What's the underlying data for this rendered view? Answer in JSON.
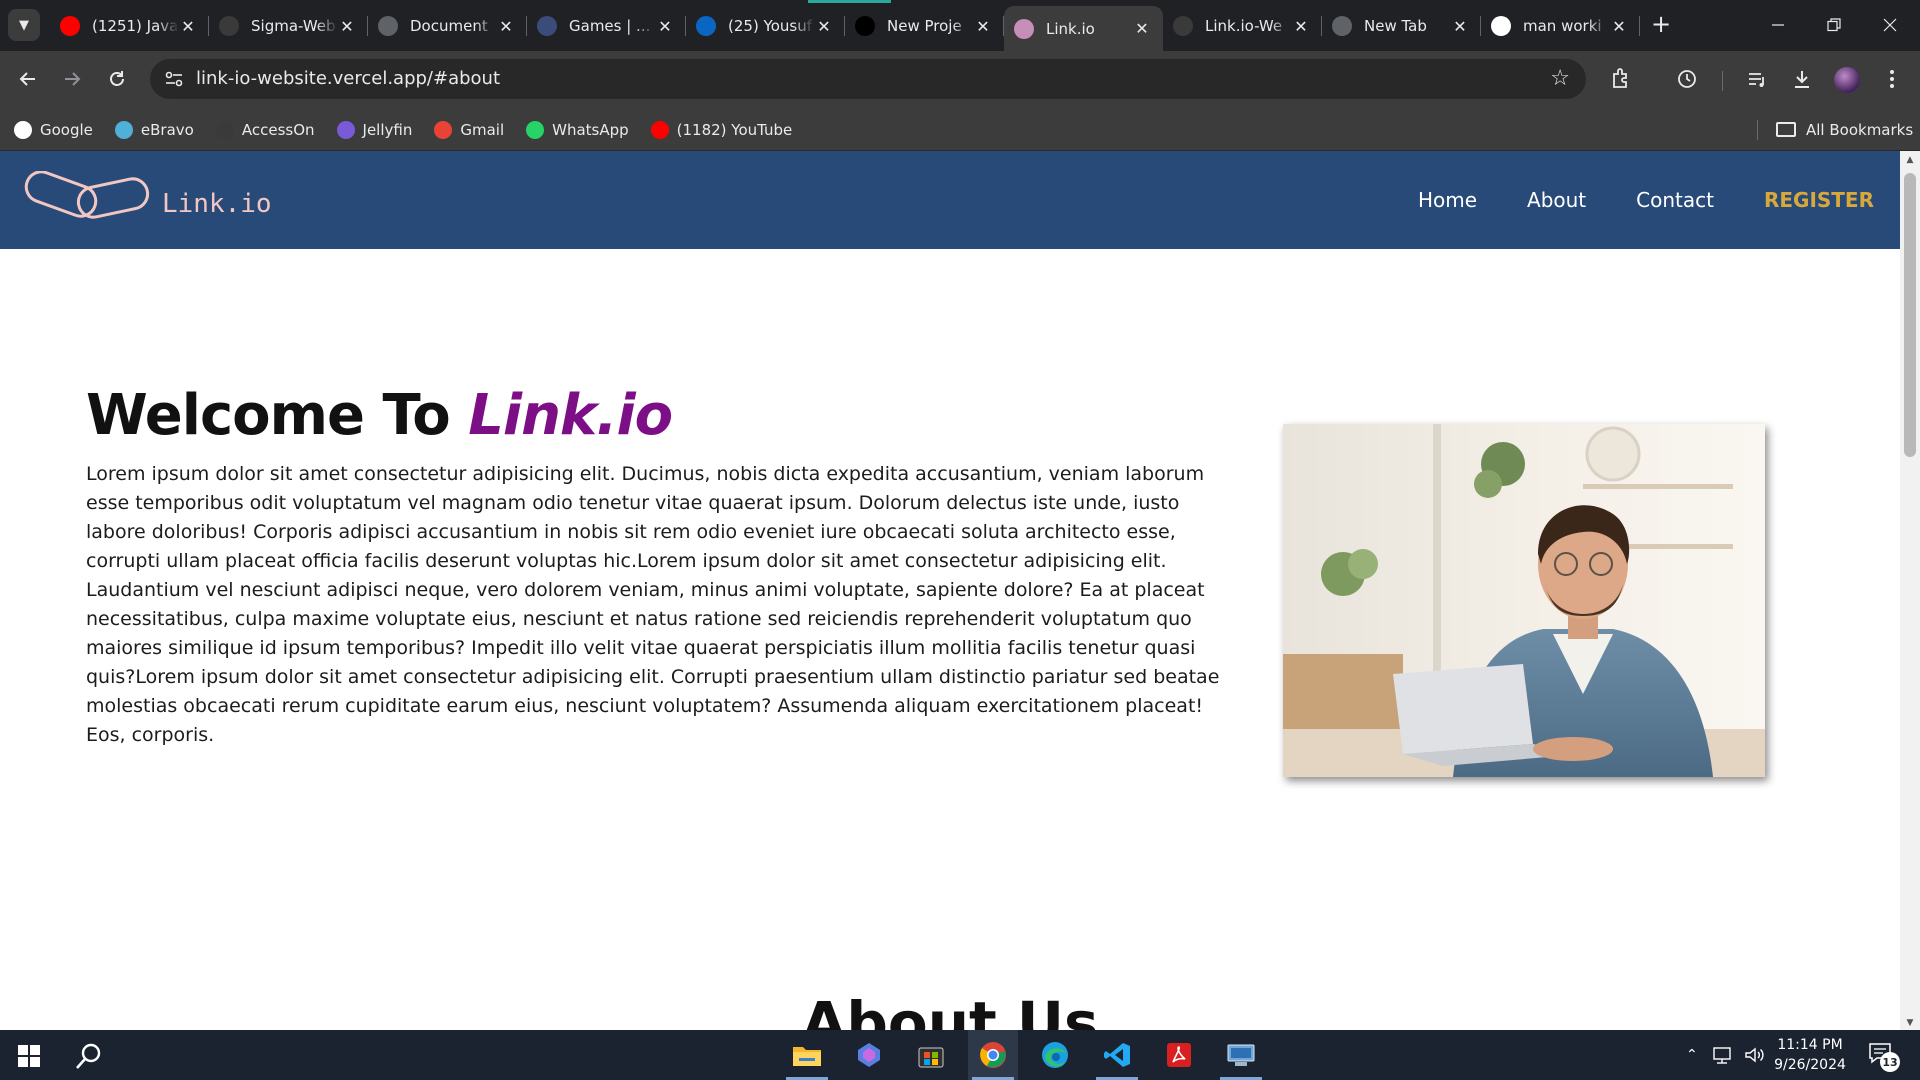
{
  "browser": {
    "tabs": [
      {
        "title": "(1251) Java",
        "favicon": "youtube-icon",
        "color": "#ff0000"
      },
      {
        "title": "Sigma-Web",
        "favicon": "github-icon",
        "color": "#3a3a3a"
      },
      {
        "title": "Document",
        "favicon": "globe-icon",
        "color": "#5f6368"
      },
      {
        "title": "Games | ...",
        "favicon": "games-icon",
        "color": "#3b4c7a"
      },
      {
        "title": "(25) Yousuf",
        "favicon": "linkedin-icon",
        "color": "#0a66c2"
      },
      {
        "title": "New Proje",
        "favicon": "vercel-icon",
        "color": "#000000"
      },
      {
        "title": "Link.io",
        "favicon": "link-icon",
        "color": "#c58fb8",
        "active": true
      },
      {
        "title": "Link.io-We",
        "favicon": "github-icon",
        "color": "#3a3a3a"
      },
      {
        "title": "New Tab",
        "favicon": "chrome-icon",
        "color": "#5f6368"
      },
      {
        "title": "man worki",
        "favicon": "google-icon",
        "color": "#ffffff"
      }
    ],
    "new_tab_label": "+",
    "url": "link-io-website.vercel.app/#about",
    "bookmarks": [
      {
        "label": "Google",
        "icon": "google-icon",
        "color": "#ffffff"
      },
      {
        "label": "eBravo",
        "icon": "ebravo-icon",
        "color": "#4fb0d8"
      },
      {
        "label": "AccessOn",
        "icon": "accesson-icon",
        "color": "#3a3a3a"
      },
      {
        "label": "Jellyfin",
        "icon": "jellyfin-icon",
        "color": "#7a5ad8"
      },
      {
        "label": "Gmail",
        "icon": "gmail-icon",
        "color": "#ea4335"
      },
      {
        "label": "WhatsApp",
        "icon": "whatsapp-icon",
        "color": "#25d366"
      },
      {
        "label": "(1182) YouTube",
        "icon": "youtube-icon",
        "color": "#ff0000"
      }
    ],
    "all_bookmarks_label": "All Bookmarks"
  },
  "site": {
    "logo_text": "Link.io",
    "nav": [
      "Home",
      "About",
      "Contact"
    ],
    "register_label": "REGISTER",
    "hero": {
      "title_prefix": "Welcome To ",
      "title_brand": "Link.io",
      "body": "Lorem ipsum dolor sit amet consectetur adipisicing elit. Ducimus, nobis dicta expedita accusantium, veniam laborum esse temporibus odit voluptatum vel magnam odio tenetur vitae quaerat ipsum. Dolorum delectus iste unde, iusto labore doloribus! Corporis adipisci accusantium in nobis sit rem odio eveniet iure obcaecati soluta architecto esse, corrupti ullam placeat officia facilis deserunt voluptas hic.Lorem ipsum dolor sit amet consectetur adipisicing elit. Laudantium vel nesciunt adipisci neque, vero dolorem veniam, minus animi voluptate, sapiente dolore? Ea at placeat necessitatibus, culpa maxime voluptate eius, nesciunt et natus ratione sed reiciendis reprehenderit voluptatum quo maiores similique id ipsum temporibus? Impedit illo velit vitae quaerat perspiciatis illum mollitia facilis tenetur quasi quis?Lorem ipsum dolor sit amet consectetur adipisicing elit. Corrupti praesentium ullam distinctio pariatur sed beatae molestias obcaecati rerum cupiditate earum eius, nesciunt voluptatem? Assumenda aliquam exercitationem placeat! Eos, corporis."
    },
    "about_heading": "About Us",
    "colors": {
      "nav_bg": "#284a78",
      "brand_purple": "#7d0f86",
      "register_gold": "#d8a93a",
      "logo_pink": "#f2c7c3"
    }
  },
  "taskbar": {
    "apps": [
      "file-explorer-icon",
      "copilot-icon",
      "microsoft-store-icon",
      "chrome-icon",
      "edge-icon",
      "vscode-icon",
      "acrobat-icon",
      "remote-desktop-icon"
    ],
    "time": "11:14 PM",
    "date": "9/26/2024",
    "notification_count": "13"
  }
}
